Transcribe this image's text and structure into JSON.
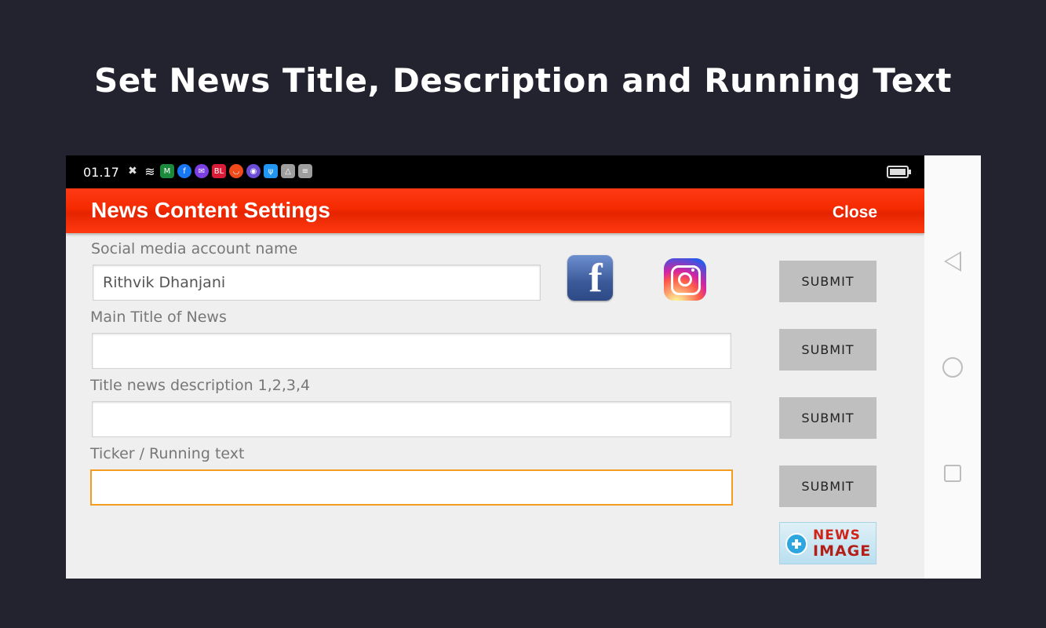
{
  "headline": "Set News Title, Description and Running Text",
  "status_bar": {
    "time": "01.17",
    "icons": [
      {
        "name": "notification-x-icon",
        "glyph": "✖",
        "color": "#9e9e9e"
      },
      {
        "name": "wifi-icon",
        "glyph": "≋",
        "color": "#000000"
      },
      {
        "name": "app-green-icon",
        "glyph": "M",
        "color": "#1b8a3a"
      },
      {
        "name": "facebook-small-icon",
        "glyph": "f",
        "color": "#1877f2"
      },
      {
        "name": "mail-icon",
        "glyph": "✉",
        "color": "#7b3fe4"
      },
      {
        "name": "bl-icon",
        "glyph": "BL",
        "color": "#d81b36"
      },
      {
        "name": "app-orange-icon",
        "glyph": "◡",
        "color": "#f04a1a"
      },
      {
        "name": "app-multicolor-icon",
        "glyph": "◉",
        "color": "#6a4cd6"
      },
      {
        "name": "usb-icon",
        "glyph": "ψ",
        "color": "#2196f3"
      },
      {
        "name": "drive-icon",
        "glyph": "△",
        "color": "#9e9e9e"
      },
      {
        "name": "storage-icon",
        "glyph": "≡",
        "color": "#9e9e9e"
      }
    ]
  },
  "app_bar": {
    "title": "News Content Settings",
    "close_label": "Close"
  },
  "form": {
    "social": {
      "label": "Social media account name",
      "value": "Rithvik Dhanjani",
      "submit": "SUBMIT"
    },
    "main_title": {
      "label": "Main Title of News",
      "value": "",
      "submit": "SUBMIT"
    },
    "description": {
      "label": "Title news description 1,2,3,4",
      "value": "",
      "submit": "SUBMIT"
    },
    "ticker": {
      "label": "Ticker / Running text",
      "value": "",
      "submit": "SUBMIT"
    }
  },
  "news_image_button": {
    "line1": "NEWS",
    "line2": "IMAGE"
  },
  "colors": {
    "background": "#23222f",
    "app_bar": "#f52a00",
    "focus_border": "#f39c1f",
    "submit_bg": "#bfbfbf"
  }
}
